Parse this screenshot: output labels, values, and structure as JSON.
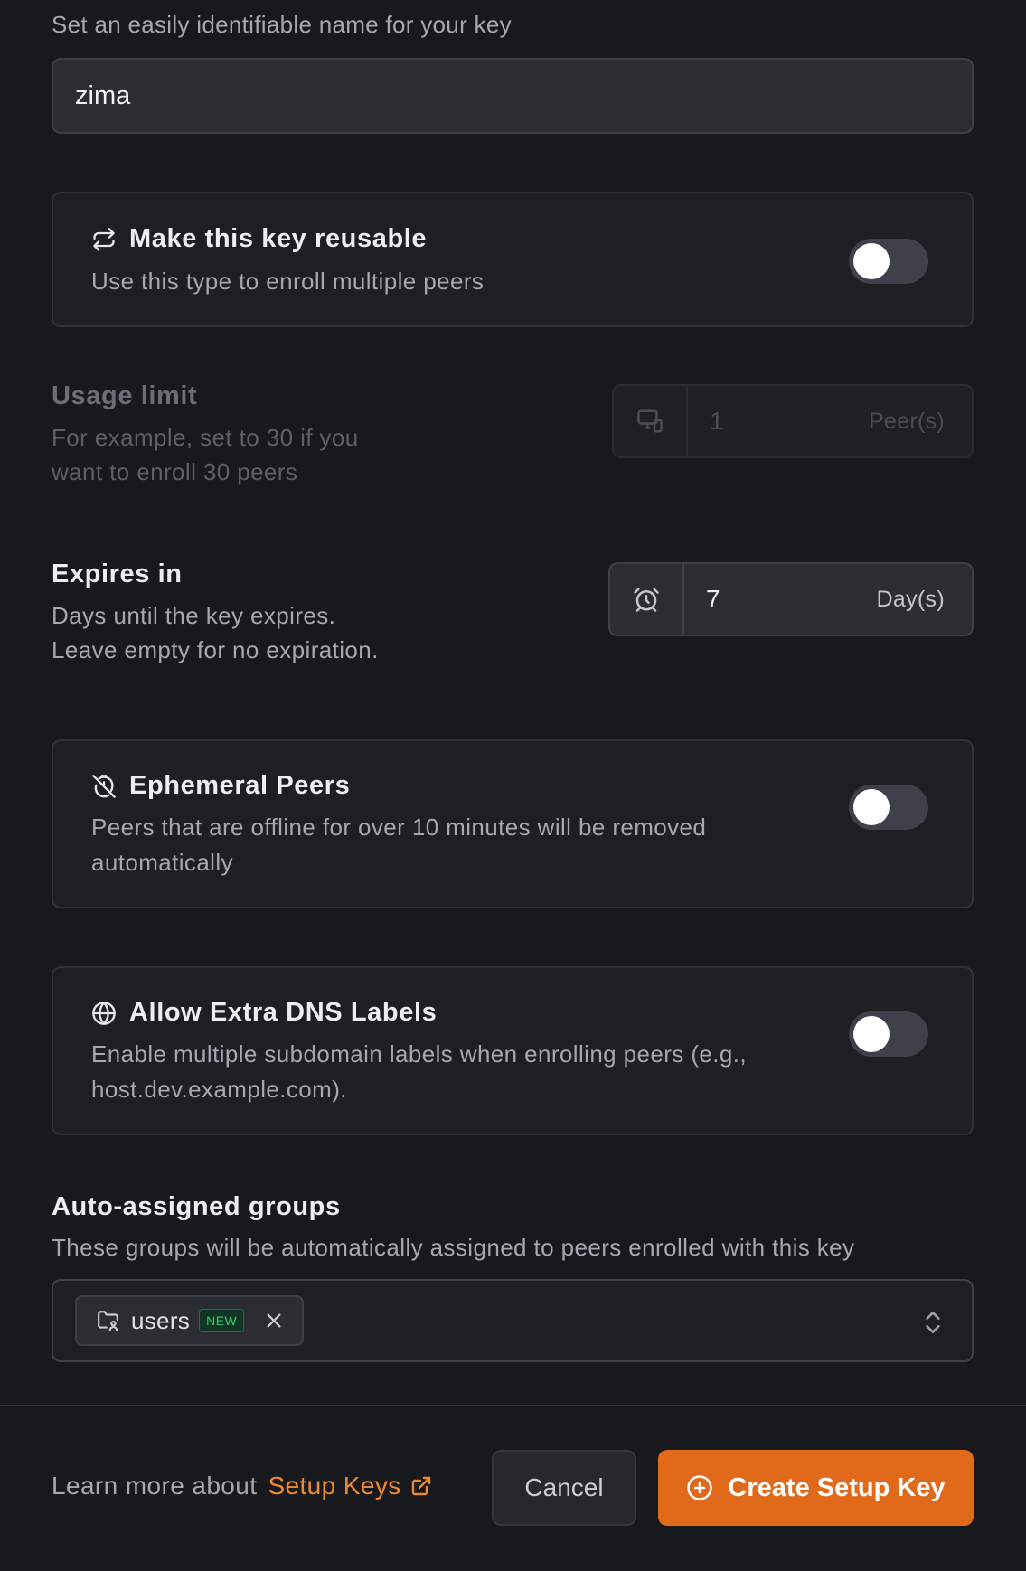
{
  "name_section": {
    "hint": "Set an easily identifiable name for your key",
    "value": "zima"
  },
  "reusable": {
    "title": "Make this key reusable",
    "description": "Use this type to enroll multiple peers",
    "enabled": false
  },
  "usage_limit": {
    "title": "Usage limit",
    "description_line1": "For example, set to 30 if you",
    "description_line2": "want to enroll 30 peers",
    "value": "1",
    "unit": "Peer(s)",
    "disabled": true
  },
  "expires": {
    "title": "Expires in",
    "description_line1": "Days until the key expires.",
    "description_line2": "Leave empty for no expiration.",
    "value": "7",
    "unit": "Day(s)"
  },
  "ephemeral": {
    "title": "Ephemeral Peers",
    "description_line1": "Peers that are offline for over 10 minutes will be removed",
    "description_line2": "automatically",
    "enabled": false
  },
  "dns_labels": {
    "title": "Allow Extra DNS Labels",
    "description_line1": "Enable multiple subdomain labels when enrolling peers (e.g.,",
    "description_line2": "host.dev.example.com).",
    "enabled": false
  },
  "groups": {
    "title": "Auto-assigned groups",
    "description": "These groups will be automatically assigned to peers enrolled with this key",
    "chips": [
      {
        "label": "users",
        "badge": "NEW"
      }
    ]
  },
  "footer": {
    "learn_prefix": "Learn more about",
    "learn_link": "Setup Keys",
    "cancel_label": "Cancel",
    "create_label": "Create Setup Key"
  },
  "colors": {
    "accent": "#e06a1a",
    "link": "#f08a2c",
    "background": "#18191c",
    "new_badge": "#2ecc71"
  },
  "icons": {
    "reusable": "repeat-icon",
    "usage_limit": "devices-icon",
    "expires": "alarm-clock-icon",
    "ephemeral": "timer-off-icon",
    "dns_labels": "globe-icon",
    "group_chip": "folder-users-icon",
    "chip_remove": "close-icon",
    "group_select": "chevron-up-down-icon",
    "learn_link": "external-link-icon",
    "create_button": "plus-circle-icon"
  }
}
